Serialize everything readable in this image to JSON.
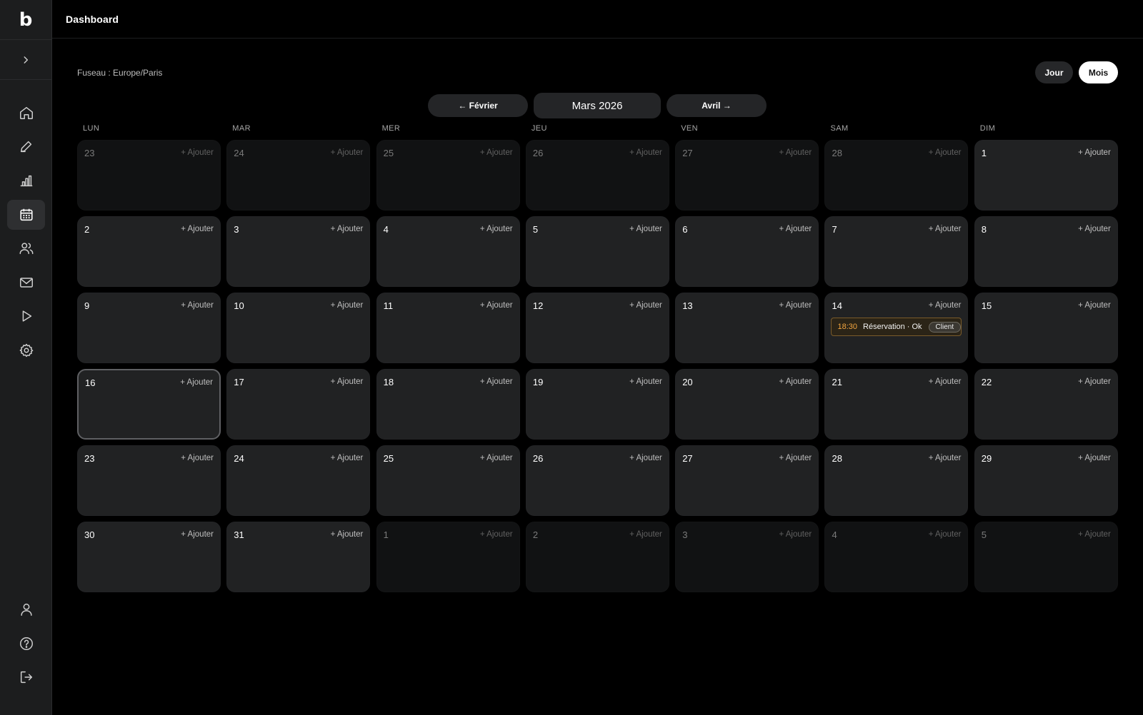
{
  "app": {
    "logo": "b",
    "title": "Dashboard"
  },
  "sidebar": {
    "nav": [
      {
        "icon": "home-icon"
      },
      {
        "icon": "pen-icon"
      },
      {
        "icon": "bar-chart-icon"
      },
      {
        "icon": "calendar-icon",
        "active": true
      },
      {
        "icon": "users-icon"
      },
      {
        "icon": "mail-icon"
      },
      {
        "icon": "play-icon"
      },
      {
        "icon": "gear-icon"
      }
    ],
    "bottom": [
      {
        "icon": "user-icon"
      },
      {
        "icon": "help-icon"
      },
      {
        "icon": "logout-icon"
      }
    ]
  },
  "calendar": {
    "timezone": "Fuseau : Europe/Paris",
    "views": {
      "day": "Jour",
      "month": "Mois",
      "selected": "Mois"
    },
    "prev_label": "← Février",
    "current_label": "Mars 2026",
    "next_label": "Avril →",
    "add_label": "+ Ajouter",
    "weekdays": [
      "LUN",
      "MAR",
      "MER",
      "JEU",
      "VEN",
      "SAM",
      "DIM"
    ],
    "days": [
      {
        "n": "23",
        "out": true
      },
      {
        "n": "24",
        "out": true
      },
      {
        "n": "25",
        "out": true
      },
      {
        "n": "26",
        "out": true
      },
      {
        "n": "27",
        "out": true
      },
      {
        "n": "28",
        "out": true
      },
      {
        "n": "1"
      },
      {
        "n": "2"
      },
      {
        "n": "3"
      },
      {
        "n": "4"
      },
      {
        "n": "5"
      },
      {
        "n": "6"
      },
      {
        "n": "7"
      },
      {
        "n": "8"
      },
      {
        "n": "9"
      },
      {
        "n": "10"
      },
      {
        "n": "11"
      },
      {
        "n": "12"
      },
      {
        "n": "13"
      },
      {
        "n": "14",
        "events": [
          {
            "time": "18:30",
            "title": "Réservation · Ok",
            "badge": "Client"
          }
        ]
      },
      {
        "n": "15"
      },
      {
        "n": "16",
        "today": true
      },
      {
        "n": "17"
      },
      {
        "n": "18"
      },
      {
        "n": "19"
      },
      {
        "n": "20"
      },
      {
        "n": "21"
      },
      {
        "n": "22"
      },
      {
        "n": "23"
      },
      {
        "n": "24"
      },
      {
        "n": "25"
      },
      {
        "n": "26"
      },
      {
        "n": "27"
      },
      {
        "n": "28"
      },
      {
        "n": "29"
      },
      {
        "n": "30"
      },
      {
        "n": "31"
      },
      {
        "n": "1",
        "out": true
      },
      {
        "n": "2",
        "out": true
      },
      {
        "n": "3",
        "out": true
      },
      {
        "n": "4",
        "out": true
      },
      {
        "n": "5",
        "out": true
      }
    ]
  },
  "colors": {
    "event_time": "#f1a43f",
    "event_border": "#7a5b2a",
    "background": "#000000"
  }
}
